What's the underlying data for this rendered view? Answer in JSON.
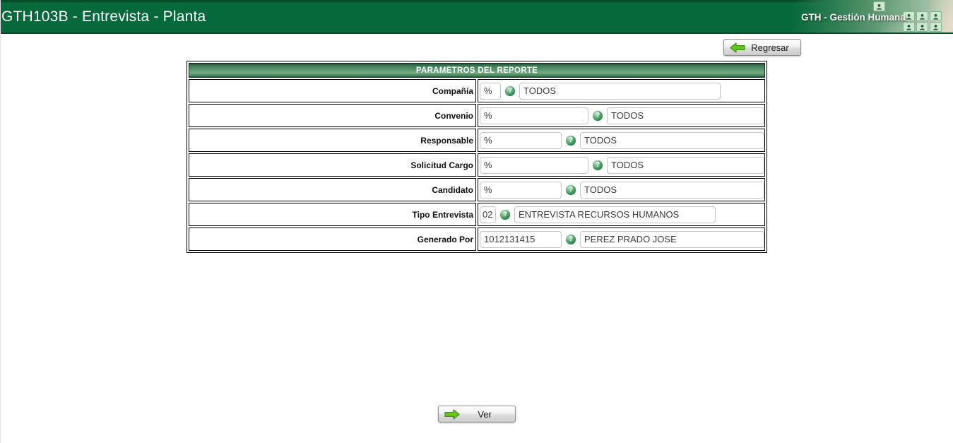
{
  "header": {
    "title": "GTH103B - Entrevista - Planta",
    "brand": "GTH - Gestión Humana"
  },
  "toolbar": {
    "back_label": "Regresar"
  },
  "report": {
    "title": "PARAMETROS DEL REPORTE",
    "rows": [
      {
        "label": "Compañía",
        "code": "%",
        "desc": "TODOS"
      },
      {
        "label": "Convenio",
        "code": "%",
        "desc": "TODOS"
      },
      {
        "label": "Responsable",
        "code": "%",
        "desc": "TODOS"
      },
      {
        "label": "Solicitud Cargo",
        "code": "%",
        "desc": "TODOS"
      },
      {
        "label": "Candidato",
        "code": "%",
        "desc": "TODOS"
      },
      {
        "label": "Tipo Entrevista",
        "code": "02",
        "desc": "ENTREVISTA RECURSOS HUMANOS"
      },
      {
        "label": "Generado Por",
        "code": "1012131415",
        "desc": "PEREZ PRADO JOSE"
      }
    ]
  },
  "actions": {
    "view_label": "Ver"
  },
  "icons": {
    "help": "?",
    "back_arrow": "left-arrow",
    "view_arrow": "right-arrow",
    "person_tile": "person"
  },
  "colors": {
    "header_green": "#06693B",
    "table_header_green": "#549068",
    "arrow_green": "#66C81E",
    "border_black": "#000000"
  }
}
